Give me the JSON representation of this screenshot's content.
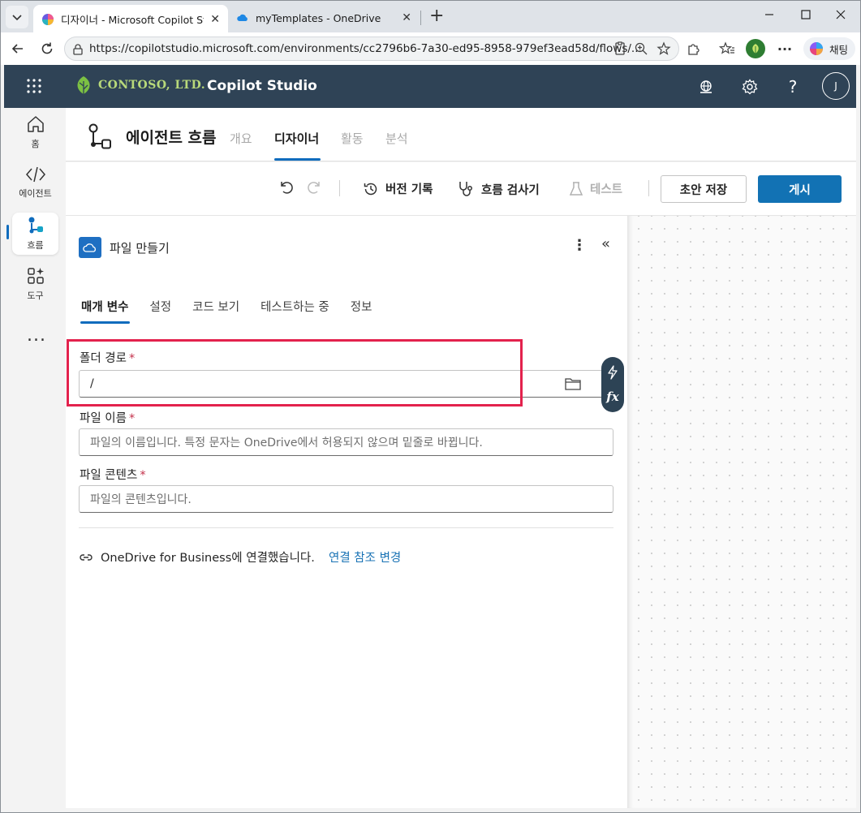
{
  "browser": {
    "tabs": [
      {
        "title": "디자이너 - Microsoft Copilot Studio",
        "active": true
      },
      {
        "title": "myTemplates - OneDrive",
        "active": false
      }
    ],
    "url": "https://copilotstudio.microsoft.com/environments/cc2796b6-7a30-ed95-8958-979ef3ead58d/flows/...",
    "chat_label": "채팅",
    "icons": [
      "tab-list-icon",
      "back-icon",
      "refresh-icon",
      "lock-icon",
      "reader-icon",
      "zoom-icon",
      "favorite-icon",
      "extensions-icon",
      "favorites-icon",
      "profile-icon",
      "more-icon",
      "copilot-icon",
      "minimize-icon",
      "maximize-icon",
      "close-icon"
    ]
  },
  "app": {
    "company": "CONTOSO, LTD.",
    "product": "Copilot Studio",
    "avatar_initial": "J",
    "header_icons": [
      "waffle-icon",
      "environment-icon",
      "settings-icon",
      "help-icon"
    ]
  },
  "rail": {
    "items": [
      {
        "label": "홈",
        "icon": "home-icon"
      },
      {
        "label": "에이전트",
        "icon": "agent-icon"
      },
      {
        "label": "흐름",
        "icon": "flow-icon",
        "active": true
      },
      {
        "label": "도구",
        "icon": "tools-icon"
      }
    ],
    "more": "..."
  },
  "page": {
    "title": "에이전트 흐름",
    "tabs": [
      {
        "label": "개요",
        "active": false
      },
      {
        "label": "디자이너",
        "active": true
      },
      {
        "label": "활동",
        "active": false
      },
      {
        "label": "분석",
        "active": false
      }
    ]
  },
  "toolbar": {
    "version_history": "버전 기록",
    "flow_checker": "흐름 검사기",
    "test": "테스트",
    "save_draft": "초안 저장",
    "publish": "게시"
  },
  "panel": {
    "title": "파일 만들기",
    "more": "⋮",
    "collapse": "«",
    "tabs": [
      {
        "label": "매개 변수",
        "active": true
      },
      {
        "label": "설정"
      },
      {
        "label": "코드 보기"
      },
      {
        "label": "테스트하는 중"
      },
      {
        "label": "정보"
      }
    ],
    "fields": {
      "folder_path": {
        "label": "폴더 경로",
        "required": "*",
        "value": "/"
      },
      "file_name": {
        "label": "파일 이름",
        "required": "*",
        "placeholder": "파일의 이름입니다. 특정 문자는 OneDrive에서 허용되지 않으며 밑줄로 바뀝니다."
      },
      "file_content": {
        "label": "파일 콘텐츠",
        "required": "*",
        "placeholder": "파일의 콘텐츠입니다."
      }
    },
    "side_pill": {
      "fx": "fx"
    },
    "connection": {
      "text": "OneDrive for Business에 연결했습니다.",
      "link": "연결 참조 변경"
    }
  },
  "colors": {
    "app_header": "#2f4356",
    "accent": "#0f6cbd",
    "publish": "#1272b4",
    "highlight": "#e3224d",
    "required": "#c4314b",
    "link": "#1a73b5"
  }
}
